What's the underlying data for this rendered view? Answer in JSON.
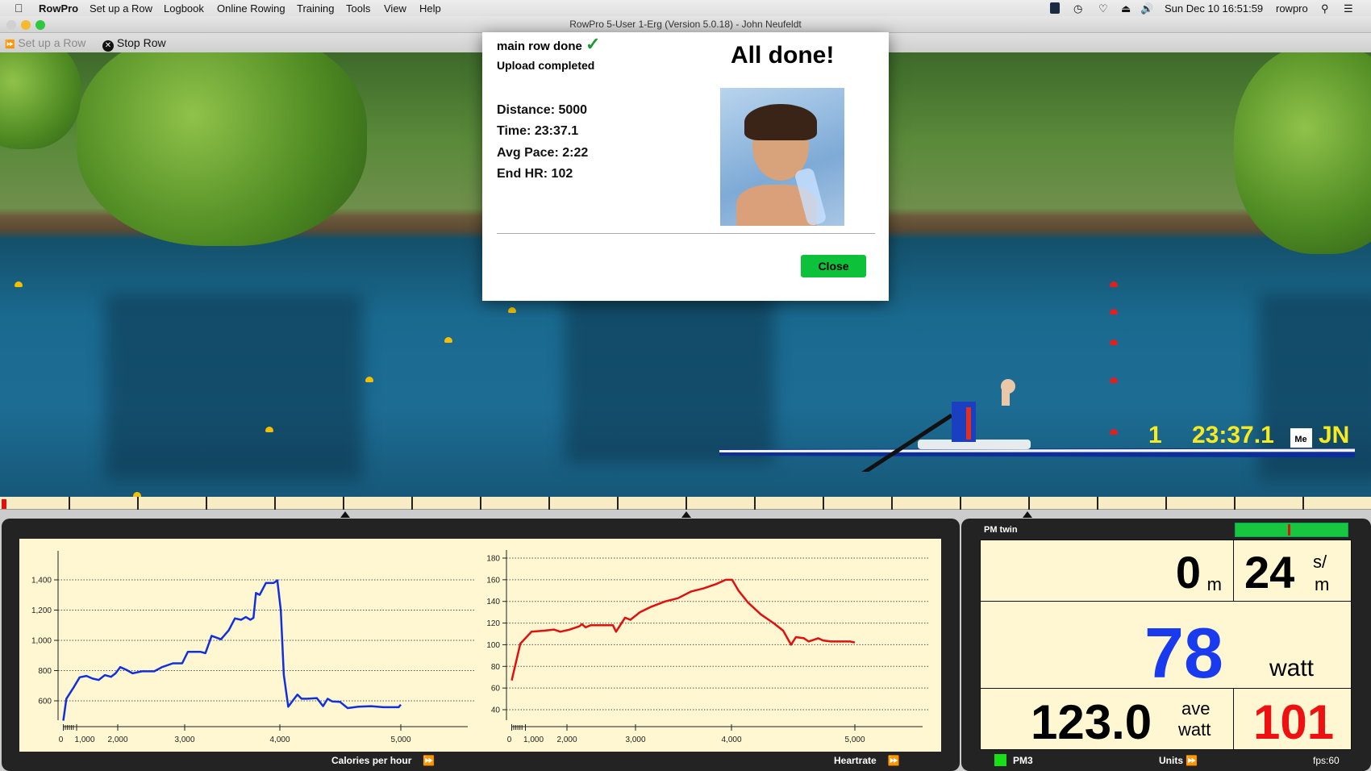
{
  "menubar": {
    "apple_icon": "apple-logo",
    "items": [
      "RowPro",
      "Set up a Row",
      "Logbook",
      "Online Rowing",
      "Training",
      "Tools",
      "View",
      "Help"
    ],
    "status": {
      "icons": [
        "rowpro-app-icon",
        "time-machine-icon",
        "wifi-icon",
        "eject-icon",
        "volume-icon"
      ],
      "clock": "Sun Dec 10  16:51:59",
      "user": "rowpro",
      "search_icon": "spotlight-icon",
      "list_icon": "notification-center-icon"
    }
  },
  "window": {
    "title": "RowPro 5-User 1-Erg (Version 5.0.18) - John Neufeldt"
  },
  "toolbar": {
    "setup_label": "Set up a Row",
    "stop_label": "Stop Row"
  },
  "dialog": {
    "status": "main row done",
    "upload": "Upload completed",
    "heading": "All done!",
    "stats": [
      "Distance: 5000",
      "Time: 23:37.1",
      "Avg Pace: 2:22",
      "End HR: 102"
    ],
    "close_label": "Close",
    "accent": "#0dc23a"
  },
  "scene": {
    "place": "1",
    "time": "23:37.1",
    "initials": "JN",
    "boat_tag": "Me"
  },
  "charts_footer": {
    "left_label": "Calories per hour",
    "right_label": "Heartrate"
  },
  "chart_data": [
    {
      "type": "line",
      "ylabel": "",
      "xlabel": "",
      "color": "#1030e0",
      "grid": true,
      "yticks": [
        600,
        800,
        1000,
        1200,
        1400
      ],
      "ytick_labels": [
        "600",
        "800",
        "1,000",
        "1,200",
        "1,400"
      ],
      "xticks": [
        0,
        1000,
        2000,
        3000,
        4000,
        5000
      ],
      "xtick_labels": [
        "0",
        "1,000",
        "2,000",
        "3,000",
        "4,000",
        "5,000"
      ],
      "points": [
        [
          0,
          469
        ],
        [
          233,
          614
        ],
        [
          814,
          694
        ],
        [
          1075,
          756
        ],
        [
          1239,
          765
        ],
        [
          1388,
          747
        ],
        [
          1537,
          738
        ],
        [
          1687,
          770
        ],
        [
          1836,
          759
        ],
        [
          1948,
          782
        ],
        [
          2037,
          823
        ],
        [
          2130,
          805
        ],
        [
          2222,
          782
        ],
        [
          2361,
          795
        ],
        [
          2546,
          795
        ],
        [
          2662,
          823
        ],
        [
          2824,
          848
        ],
        [
          2963,
          848
        ],
        [
          3033,
          924
        ],
        [
          3169,
          924
        ],
        [
          3218,
          915
        ],
        [
          3283,
          1030
        ],
        [
          3381,
          1007
        ],
        [
          3463,
          1066
        ],
        [
          3528,
          1145
        ],
        [
          3593,
          1136
        ],
        [
          3642,
          1154
        ],
        [
          3691,
          1136
        ],
        [
          3723,
          1149
        ],
        [
          3749,
          1313
        ],
        [
          3788,
          1301
        ],
        [
          3853,
          1379
        ],
        [
          3935,
          1379
        ],
        [
          3974,
          1397
        ],
        [
          4008,
          1198
        ],
        [
          4033,
          773
        ],
        [
          4069,
          561
        ],
        [
          4102,
          596
        ],
        [
          4145,
          641
        ],
        [
          4179,
          614
        ],
        [
          4230,
          614
        ],
        [
          4306,
          618
        ],
        [
          4357,
          565
        ],
        [
          4395,
          614
        ],
        [
          4434,
          596
        ],
        [
          4497,
          593
        ],
        [
          4561,
          552
        ],
        [
          4650,
          561
        ],
        [
          4753,
          565
        ],
        [
          4855,
          558
        ],
        [
          4982,
          558
        ],
        [
          5000,
          575
        ]
      ]
    },
    {
      "type": "line",
      "ylabel": "",
      "xlabel": "",
      "color": "#e01010",
      "grid": true,
      "yticks": [
        40,
        60,
        80,
        100,
        120,
        140,
        160,
        180
      ],
      "ytick_labels": [
        "40",
        "60",
        "80",
        "100",
        "120",
        "140",
        "160",
        "180"
      ],
      "xticks": [
        0,
        1000,
        2000,
        3000,
        4000,
        5000
      ],
      "xtick_labels": [
        "0",
        "1,000",
        "2,000",
        "3,000",
        "4,000",
        "5,000"
      ],
      "points": [
        [
          0,
          67
        ],
        [
          628,
          101
        ],
        [
          1146,
          112
        ],
        [
          1454,
          113
        ],
        [
          1685,
          114
        ],
        [
          1838,
          112
        ],
        [
          2042,
          114
        ],
        [
          2181,
          117
        ],
        [
          2219,
          119
        ],
        [
          2274,
          116
        ],
        [
          2344,
          118
        ],
        [
          2670,
          118
        ],
        [
          2716,
          112
        ],
        [
          2847,
          125
        ],
        [
          2926,
          123
        ],
        [
          3046,
          130
        ],
        [
          3162,
          135
        ],
        [
          3311,
          140
        ],
        [
          3444,
          143
        ],
        [
          3576,
          149
        ],
        [
          3709,
          152
        ],
        [
          3841,
          156
        ],
        [
          3940,
          160
        ],
        [
          4005,
          160
        ],
        [
          4057,
          150
        ],
        [
          4134,
          139
        ],
        [
          4238,
          128
        ],
        [
          4341,
          120
        ],
        [
          4419,
          113
        ],
        [
          4483,
          100
        ],
        [
          4522,
          107
        ],
        [
          4587,
          106
        ],
        [
          4625,
          103
        ],
        [
          4703,
          106
        ],
        [
          4742,
          104
        ],
        [
          4806,
          103
        ],
        [
          4961,
          103
        ],
        [
          5000,
          102
        ]
      ]
    }
  ],
  "monitor": {
    "title": "PM twin",
    "balance_fraction": 0.46,
    "distance": "0",
    "distance_unit": "m",
    "rate": "24",
    "rate_unit_top": "s/",
    "rate_unit_bottom": "m",
    "watts": "78",
    "watts_unit": "watt",
    "avg_watts": "123.0",
    "avg_unit_top": "ave",
    "avg_unit_bottom": "watt",
    "heart_rate": "101",
    "pm_label": "PM3",
    "units_label": "Units",
    "fps": "fps:60",
    "watts_color": "#1a3af0",
    "hr_color": "#ee1111"
  }
}
